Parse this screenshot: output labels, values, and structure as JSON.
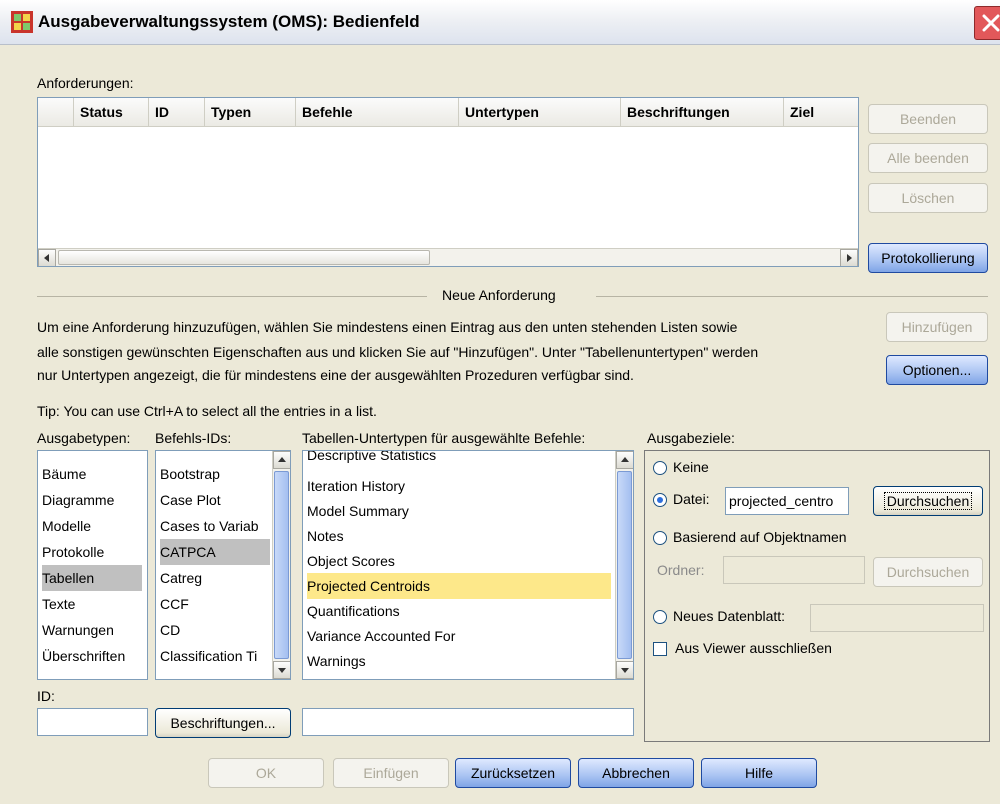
{
  "window": {
    "title": "Ausgabeverwaltungssystem (OMS): Bedienfeld"
  },
  "requests": {
    "label": "Anforderungen:",
    "columns": [
      "Status",
      "ID",
      "Typen",
      "Befehle",
      "Untertypen",
      "Beschriftungen",
      "Ziel"
    ],
    "buttons": {
      "end": "Beenden",
      "end_all": "Alle beenden",
      "delete": "Löschen",
      "logging": "Protokollierung"
    }
  },
  "new_request": {
    "heading": "Neue Anforderung",
    "instructions": [
      "Um eine Anforderung hinzuzufügen, wählen Sie mindestens einen Eintrag aus den unten stehenden Listen sowie",
      "alle sonstigen gewünschten Eigenschaften aus und klicken Sie auf \"Hinzufügen\". Unter \"Tabellenuntertypen\" werden",
      "nur Untertypen angezeigt, die für mindestens eine der ausgewählten Prozeduren verfügbar sind."
    ],
    "add_button": "Hinzufügen",
    "options_button": "Optionen...",
    "tip": "Tip: You can use Ctrl+A to select all the entries in a list."
  },
  "output_types": {
    "label": "Ausgabetypen:",
    "items": [
      "Bäume",
      "Diagramme",
      "Modelle",
      "Protokolle",
      "Tabellen",
      "Texte",
      "Warnungen",
      "Überschriften"
    ],
    "selected": "Tabellen"
  },
  "command_ids": {
    "label": "Befehls-IDs:",
    "items": [
      "Bootstrap",
      "Case Plot",
      "Cases to Variab",
      "CATPCA",
      "Catreg",
      "CCF",
      "CD",
      "Classification Ti"
    ],
    "selected": "CATPCA"
  },
  "table_subtypes": {
    "label": "Tabellen-Untertypen für ausgewählte Befehle:",
    "items": [
      "Descriptive Statistics",
      "Iteration History",
      "Model Summary",
      "Notes",
      "Object Scores",
      "Projected Centroids",
      "Quantifications",
      "Variance Accounted For",
      "Warnings"
    ],
    "selected": "Projected Centroids"
  },
  "id_field": {
    "label": "ID:",
    "value": ""
  },
  "labels_button": "Beschriftungen...",
  "labels_field": {
    "value": ""
  },
  "destinations": {
    "label": "Ausgabeziele:",
    "none": "Keine",
    "file": "Datei:",
    "file_value": "projected_centro",
    "browse": "Durchsuchen",
    "by_object": "Basierend auf Objektnamen",
    "folder": "Ordner:",
    "folder_value": "",
    "browse2": "Durchsuchen",
    "new_dataset": "Neues Datenblatt:",
    "dataset_value": "",
    "exclude": "Aus Viewer ausschließen",
    "selected": "Datei:"
  },
  "footer": {
    "ok": "OK",
    "paste": "Einfügen",
    "reset": "Zurücksetzen",
    "cancel": "Abbrechen",
    "help": "Hilfe"
  },
  "colors": {
    "selection": "#c0c0c0",
    "highlight": "#fde88a",
    "dialog_bg": "#ece9d8"
  }
}
